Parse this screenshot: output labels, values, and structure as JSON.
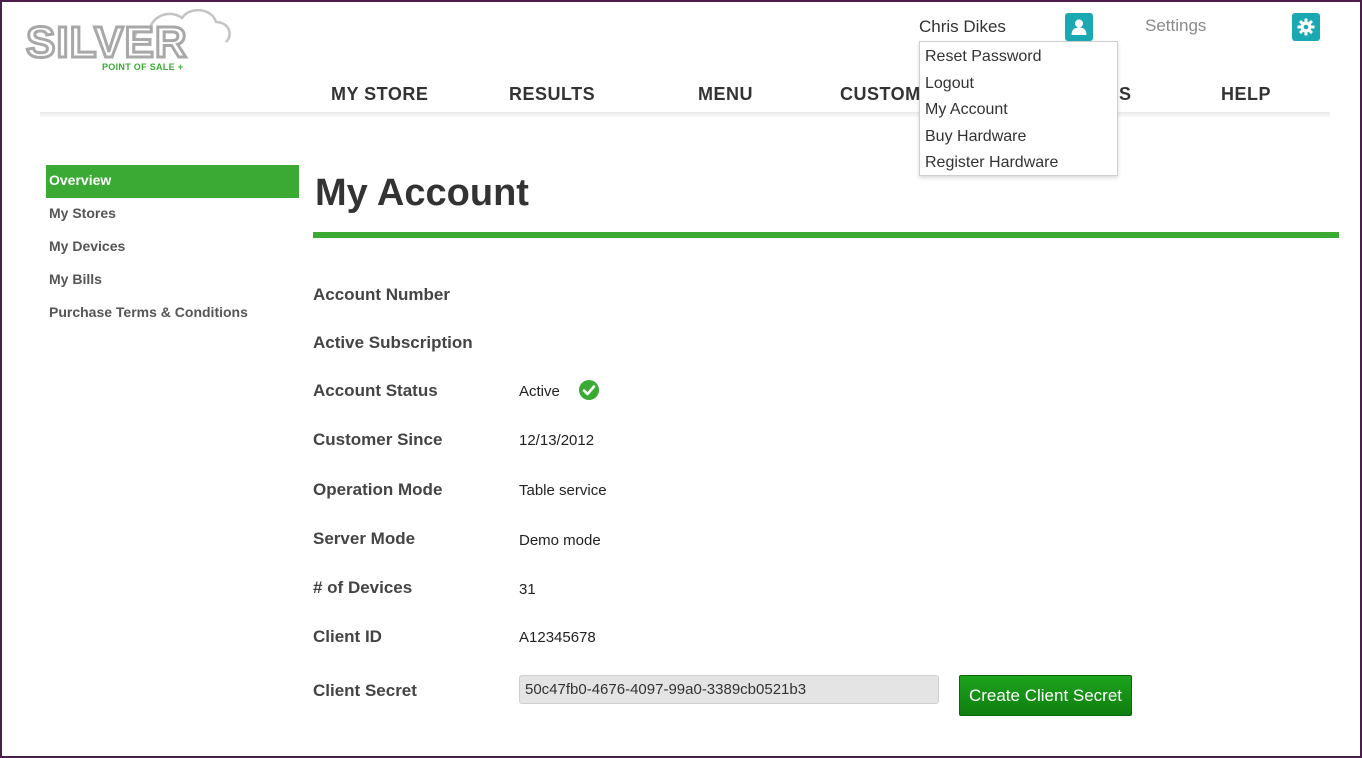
{
  "brand": {
    "name": "SILVER",
    "tagline": "POINT OF SALE +",
    "accent_color": "#3aaa35",
    "teal_color": "#1aa9b3"
  },
  "header": {
    "user_name": "Chris Dikes",
    "user_icon": "user-icon",
    "settings_label": "Settings",
    "settings_icon": "gear-icon"
  },
  "nav": {
    "items": [
      {
        "label": "MY STORE"
      },
      {
        "label": "RESULTS"
      },
      {
        "label": "MENU"
      },
      {
        "label": "CUSTOM"
      },
      {
        "label": "S"
      },
      {
        "label": "HELP"
      }
    ]
  },
  "user_menu": {
    "items": [
      {
        "label": "Reset Password"
      },
      {
        "label": "Logout"
      },
      {
        "label": "My Account"
      },
      {
        "label": "Buy Hardware"
      },
      {
        "label": "Register Hardware"
      }
    ]
  },
  "sidebar": {
    "items": [
      {
        "label": "Overview",
        "active": true
      },
      {
        "label": "My Stores",
        "active": false
      },
      {
        "label": "My Devices",
        "active": false
      },
      {
        "label": "My Bills",
        "active": false
      },
      {
        "label": "Purchase Terms & Conditions",
        "active": false
      }
    ]
  },
  "main": {
    "title": "My Account",
    "fields": [
      {
        "label": "Account Number",
        "value": ""
      },
      {
        "label": "Active Subscription",
        "value": ""
      },
      {
        "label": "Account Status",
        "value": "Active",
        "status_icon": "check-circle-icon"
      },
      {
        "label": "Customer Since",
        "value": "12/13/2012"
      },
      {
        "label": "Operation Mode",
        "value": "Table service"
      },
      {
        "label": "Server Mode",
        "value": "Demo mode"
      },
      {
        "label": "# of Devices",
        "value": "31"
      },
      {
        "label": "Client ID",
        "value": "A12345678"
      }
    ],
    "client_secret": {
      "label": "Client Secret",
      "value": "50c47fb0-4676-4097-99a0-3389cb0521b3",
      "button_label": "Create Client Secret"
    }
  }
}
